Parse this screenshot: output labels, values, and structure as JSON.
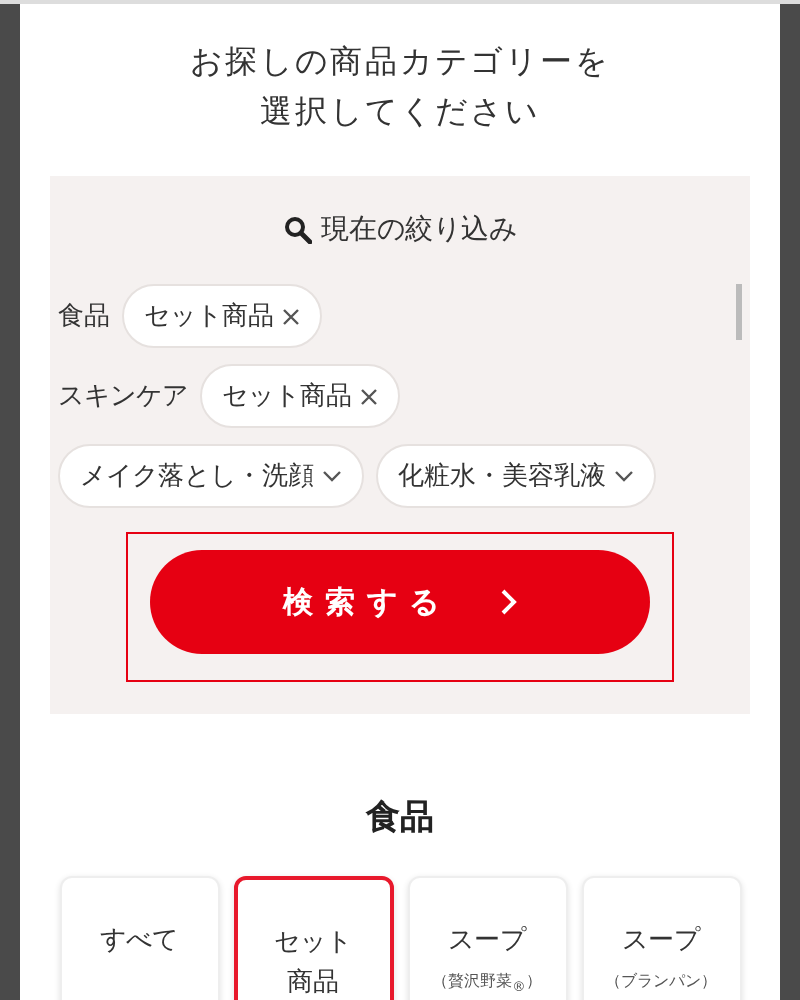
{
  "heading": {
    "lines": [
      "お探しの商品カテゴリーを",
      "選択してください"
    ]
  },
  "filter": {
    "title": "現在の絞り込み",
    "groups": [
      {
        "label": "食品",
        "chips": [
          {
            "text": "セット商品",
            "kind": "remove"
          }
        ]
      },
      {
        "label": "スキンケア",
        "chips": [
          {
            "text": "セット商品",
            "kind": "remove"
          }
        ]
      },
      {
        "chips": [
          {
            "text": "メイク落とし・洗顔",
            "kind": "expand"
          },
          {
            "text": "化粧水・美容乳液",
            "kind": "expand"
          }
        ]
      }
    ]
  },
  "search_button": {
    "label": "検索する"
  },
  "section": {
    "title": "食品",
    "categories": [
      {
        "lines": [
          "すべて"
        ],
        "selected": false
      },
      {
        "lines": [
          "セット",
          "商品"
        ],
        "selected": true
      },
      {
        "lines": [
          "スープ"
        ],
        "note": "（贅沢野菜$_{®}$）",
        "selected": false
      },
      {
        "lines": [
          "スープ"
        ],
        "note": "（ブランパン）",
        "selected": false
      }
    ]
  }
}
